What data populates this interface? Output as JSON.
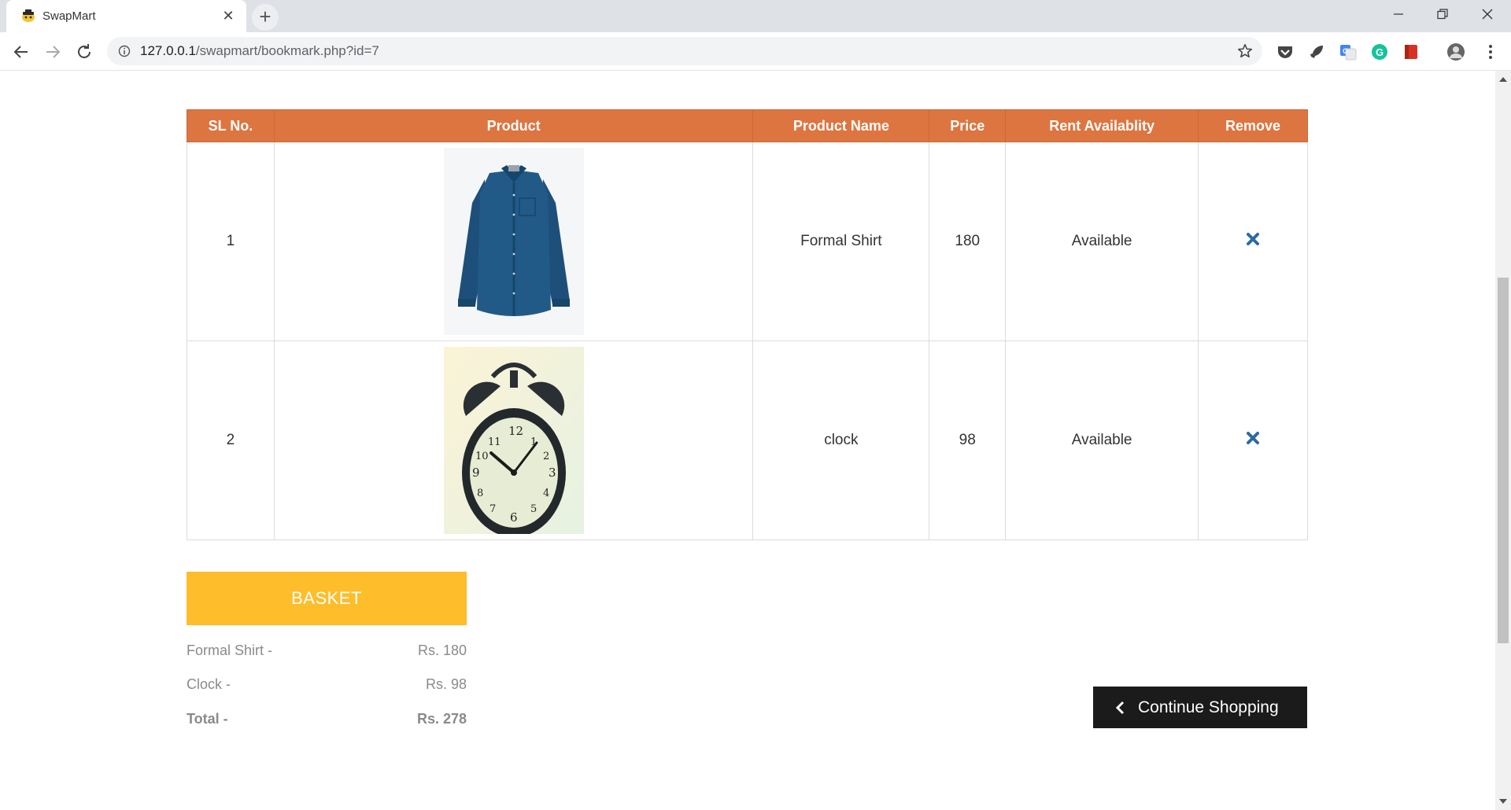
{
  "browser": {
    "tab_title": "SwapMart",
    "url_host": "127.0.0.1",
    "url_path": "/swapmart/bookmark.php?id=7"
  },
  "table": {
    "headers": [
      "SL No.",
      "Product",
      "Product Name",
      "Price",
      "Rent Availablity",
      "Remove"
    ],
    "rows": [
      {
        "sl": "1",
        "product_image": "blue-formal-shirt",
        "name": "Formal Shirt",
        "price": "180",
        "availability": "Available"
      },
      {
        "sl": "2",
        "product_image": "alarm-clock",
        "name": "clock",
        "price": "98",
        "availability": "Available"
      }
    ]
  },
  "basket": {
    "button_label": "BASKET",
    "items": [
      {
        "label": "Formal Shirt -",
        "amount": "Rs. 180"
      },
      {
        "label": "Clock -",
        "amount": "Rs. 98"
      }
    ],
    "total_label": "Total -",
    "total_amount": "Rs. 278"
  },
  "continue_label": "Continue Shopping",
  "colors": {
    "header_orange": "#dd7541",
    "basket_yellow": "#febd2a",
    "remove_blue": "#2b6aa3",
    "continue_dark": "#1b1b1b"
  }
}
